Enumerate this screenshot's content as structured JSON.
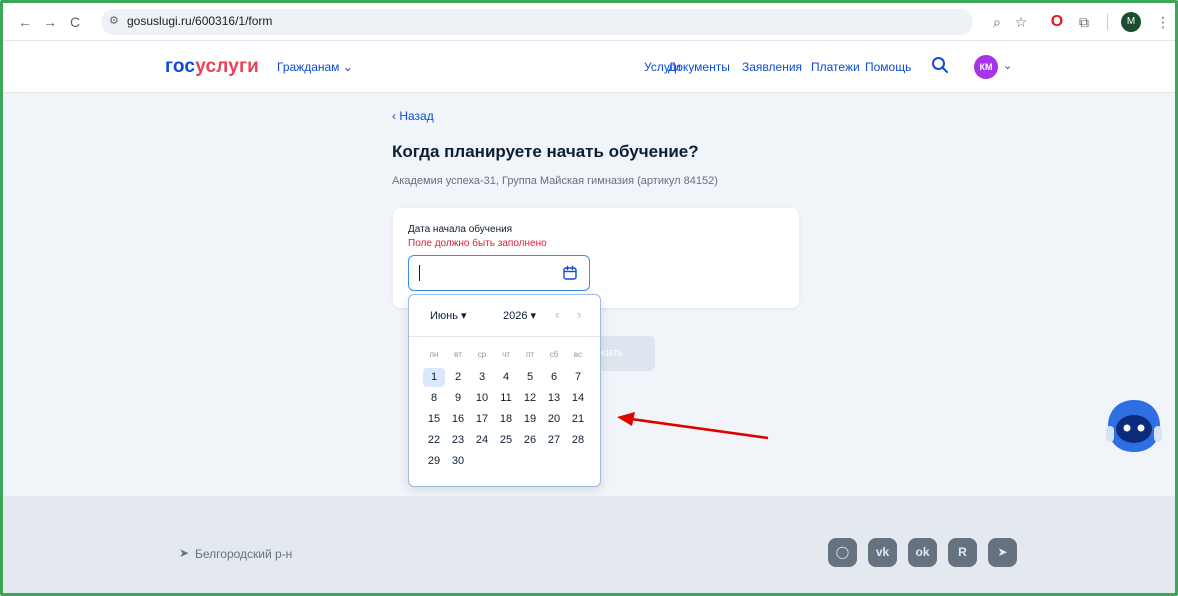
{
  "browser": {
    "url": "gosuslugi.ru/600316/1/form",
    "profile_initial": "M"
  },
  "header": {
    "logo_part1": "гос",
    "logo_part2": "услуги",
    "citizens_label": "Гражданам ⌄",
    "nav": [
      "Услуги",
      "Документы",
      "Заявления",
      "Платежи",
      "Помощь"
    ],
    "user_initials": "КМ"
  },
  "main": {
    "back_label": "‹ Назад",
    "title": "Когда планируете начать обучение?",
    "subtitle": "Академия успеха-31, Группа Майская гимназия (артикул 84152)",
    "field_label": "Дата начала обучения",
    "field_error": "Поле должно быть заполнено",
    "date_value": "",
    "continue_label": "жить"
  },
  "datepicker": {
    "month": "Июнь",
    "year": "2026",
    "weekdays": [
      "пн",
      "вт",
      "ср",
      "чт",
      "пт",
      "сб",
      "вс"
    ],
    "days": [
      "1",
      "2",
      "3",
      "4",
      "5",
      "6",
      "7",
      "8",
      "9",
      "10",
      "11",
      "12",
      "13",
      "14",
      "15",
      "16",
      "17",
      "18",
      "19",
      "20",
      "21",
      "22",
      "23",
      "24",
      "25",
      "26",
      "27",
      "28",
      "29",
      "30"
    ],
    "selected_day": "1"
  },
  "footer": {
    "region": "Белгородский р-н",
    "social": [
      "max-icon",
      "vk-icon",
      "ok-icon",
      "rutube-icon",
      "telegram-icon"
    ]
  },
  "colors": {
    "brand_blue": "#0d4cd3",
    "brand_red": "#ee3f58",
    "error": "#e21b35",
    "avatar": "#a734ea",
    "annotation": "#e00000"
  }
}
